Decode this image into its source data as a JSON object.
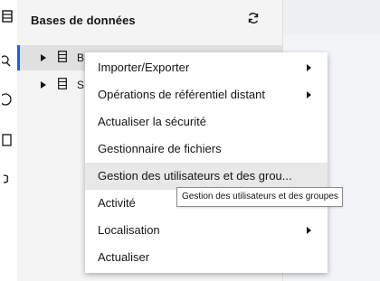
{
  "panel": {
    "title": "Bases de données"
  },
  "tree": {
    "items": [
      {
        "label": "B",
        "selected": true
      },
      {
        "label": "S",
        "selected": false
      }
    ]
  },
  "context_menu": {
    "items": [
      {
        "label": "Importer/Exporter",
        "has_submenu": true
      },
      {
        "label": "Opérations de référentiel distant",
        "has_submenu": true
      },
      {
        "label": "Actualiser la sécurité",
        "has_submenu": false
      },
      {
        "label": "Gestionnaire de fichiers",
        "has_submenu": false
      },
      {
        "label": "Gestion des utilisateurs et des grou...",
        "has_submenu": false,
        "hovered": true
      },
      {
        "label": "Activité",
        "has_submenu": false
      },
      {
        "label": "Localisation",
        "has_submenu": true
      },
      {
        "label": "Actualiser",
        "has_submenu": false
      }
    ]
  },
  "tooltip": {
    "text": "Gestion des utilisateurs et des groupes"
  },
  "colors": {
    "accent": "#0f62fe",
    "selected_row": "#e0e0e0",
    "menu_hover": "#e8e8e8"
  }
}
